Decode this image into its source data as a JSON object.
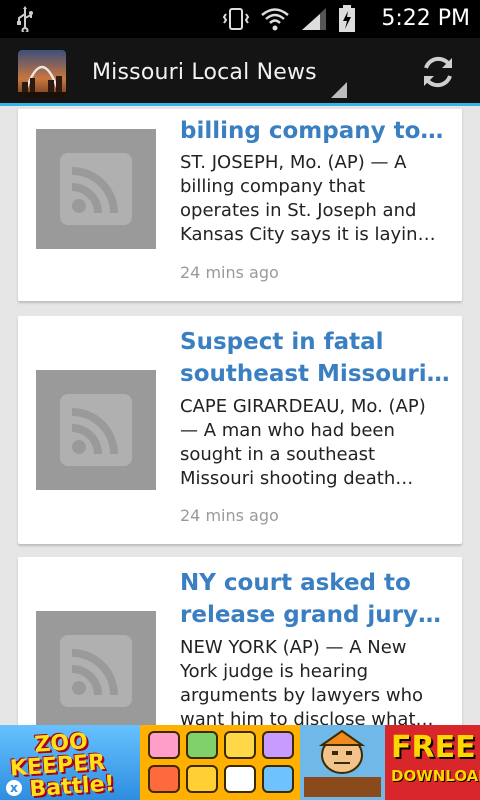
{
  "status_bar": {
    "time": "5:22 PM",
    "icons": [
      "usb-icon",
      "vibrate-icon",
      "wifi-icon",
      "signal-icon",
      "battery-charging-icon"
    ]
  },
  "action_bar": {
    "title": "Missouri Local News",
    "app_icon": "st-louis-arch-icon",
    "refresh_icon": "refresh-icon",
    "accent_color": "#33b5e5"
  },
  "articles": [
    {
      "headline": "billing company to…",
      "snippet": [
        "ST. JOSEPH, Mo. (AP) — A",
        "billing company that",
        "operates in St. Joseph and",
        "Kansas City says it is layin…"
      ],
      "time_ago": "24 mins ago",
      "thumbnail_icon": "rss-feed-icon"
    },
    {
      "headline": [
        "Suspect in fatal",
        "southeast Missouri…"
      ],
      "snippet": [
        "CAPE GIRARDEAU, Mo. (AP)",
        "— A man who had been",
        "sought in a southeast",
        "Missouri shooting death…"
      ],
      "time_ago": "24 mins ago",
      "thumbnail_icon": "rss-feed-icon"
    },
    {
      "headline": [
        "NY court asked to",
        "release grand jury…"
      ],
      "snippet": [
        "NEW YORK (AP) — A New",
        "York judge is hearing",
        "arguments by lawyers who",
        "want him to disclose what…"
      ],
      "time_ago": "",
      "thumbnail_icon": "rss-feed-icon"
    }
  ],
  "ad_banner": {
    "game_title": [
      "ZOO",
      "KEEPER",
      "Battle!"
    ],
    "cta": [
      "FREE",
      "DOWNLOAD"
    ],
    "close_label": "x"
  },
  "colors": {
    "headline": "#3a7fc1",
    "time_ago": "#9a9a9a",
    "background": "#e6e6e6"
  }
}
